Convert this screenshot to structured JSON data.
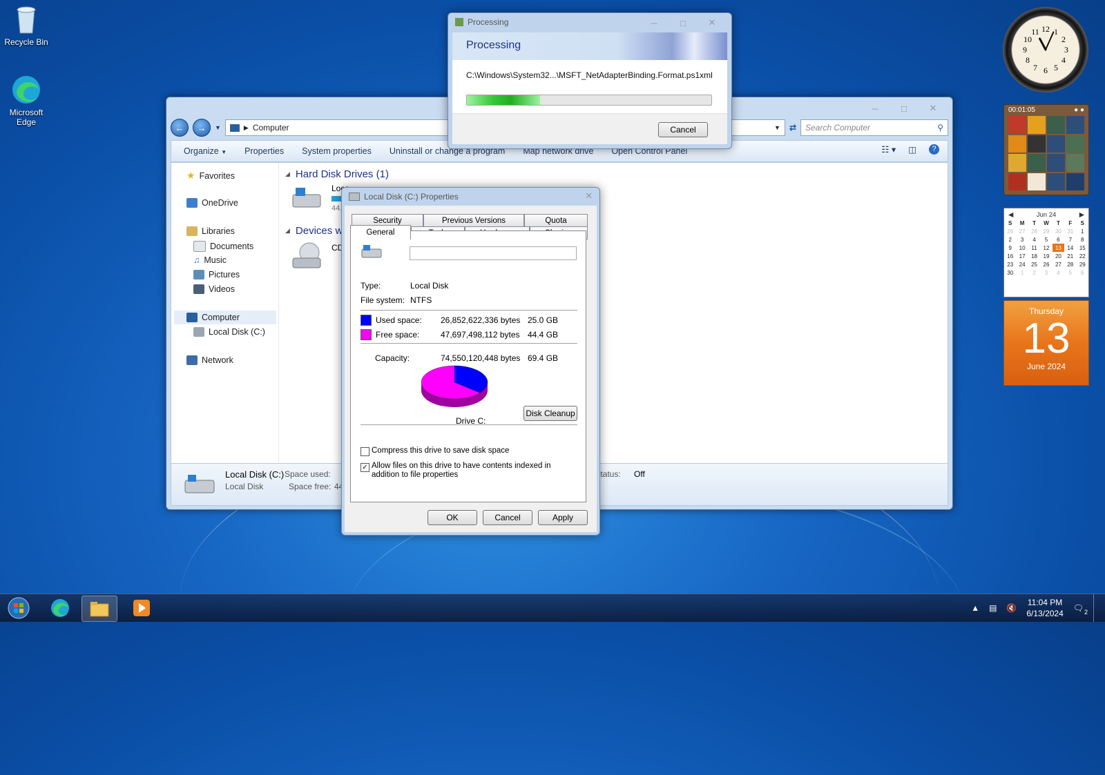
{
  "desktop": {
    "icons": [
      {
        "label": "Recycle Bin",
        "icon": "recycle-bin-icon"
      },
      {
        "label": "Microsoft Edge",
        "icon": "edge-icon"
      }
    ]
  },
  "explorer": {
    "address": "Computer",
    "search_placeholder": "Search Computer",
    "toolbar": [
      "Organize",
      "Properties",
      "System properties",
      "Uninstall or change a program",
      "Map network drive",
      "Open Control Panel"
    ],
    "nav": {
      "favorites": "Favorites",
      "onedrive": "OneDrive",
      "libraries": "Libraries",
      "documents": "Documents",
      "music": "Music",
      "pictures": "Pictures",
      "videos": "Videos",
      "computer": "Computer",
      "local_disk": "Local Disk (C:)",
      "network": "Network"
    },
    "groups": {
      "hdd": "Hard Disk Drives (1)",
      "devices": "Devices wi",
      "drive_label": "Loca",
      "drive_size": "44.4",
      "cd_label": "CD"
    },
    "details": {
      "name": "Local Disk (C:)",
      "type": "Local Disk",
      "space_used_label": "Space used:",
      "space_free_label": "Space free:",
      "space_free_val": "44",
      "status_label": "r status:",
      "status_val": "Off"
    }
  },
  "processing": {
    "title": "Processing",
    "heading": "Processing",
    "path": "C:\\Windows\\System32...\\MSFT_NetAdapterBinding.Format.ps1xml",
    "progress": 0.3,
    "cancel": "Cancel"
  },
  "properties": {
    "title": "Local Disk (C:) Properties",
    "tabs_top": [
      "Security",
      "Previous Versions",
      "Quota"
    ],
    "tabs_bottom": [
      "General",
      "Tools",
      "Hardware",
      "Sharing"
    ],
    "active_tab": "General",
    "name_value": "",
    "type_label": "Type:",
    "type_value": "Local Disk",
    "fs_label": "File system:",
    "fs_value": "NTFS",
    "used_label": "Used space:",
    "used_bytes": "26,852,622,336 bytes",
    "used_gb": "25.0 GB",
    "used_color": "#0000ff",
    "free_label": "Free space:",
    "free_bytes": "47,697,498,112 bytes",
    "free_gb": "44.4 GB",
    "free_color": "#ff00ff",
    "capacity_label": "Capacity:",
    "capacity_bytes": "74,550,120,448 bytes",
    "capacity_gb": "69.4 GB",
    "drive_label": "Drive C:",
    "disk_cleanup": "Disk Cleanup",
    "compress_label": "Compress this drive to save disk space",
    "compress_checked": false,
    "index_label": "Allow files on this drive to have contents indexed in addition to file properties",
    "index_checked": true,
    "ok": "OK",
    "cancel": "Cancel",
    "apply": "Apply"
  },
  "gadgets": {
    "timer": "00:01:05",
    "calendar_month": "Jun 24",
    "weekdays": [
      "S",
      "M",
      "T",
      "W",
      "T",
      "F",
      "S"
    ],
    "weeks": [
      [
        "26",
        "27",
        "28",
        "29",
        "30",
        "31",
        "1"
      ],
      [
        "2",
        "3",
        "4",
        "5",
        "6",
        "7",
        "8"
      ],
      [
        "9",
        "10",
        "11",
        "12",
        "13",
        "14",
        "15"
      ],
      [
        "16",
        "17",
        "18",
        "19",
        "20",
        "21",
        "22"
      ],
      [
        "23",
        "24",
        "25",
        "26",
        "27",
        "28",
        "29"
      ],
      [
        "30",
        "1",
        "2",
        "3",
        "4",
        "5",
        "6"
      ]
    ],
    "today": "13",
    "day_name": "Thursday",
    "day_number": "13",
    "month_year": "June 2024"
  },
  "taskbar": {
    "time": "11:04 PM",
    "date": "6/13/2024",
    "notif_count": "2"
  }
}
